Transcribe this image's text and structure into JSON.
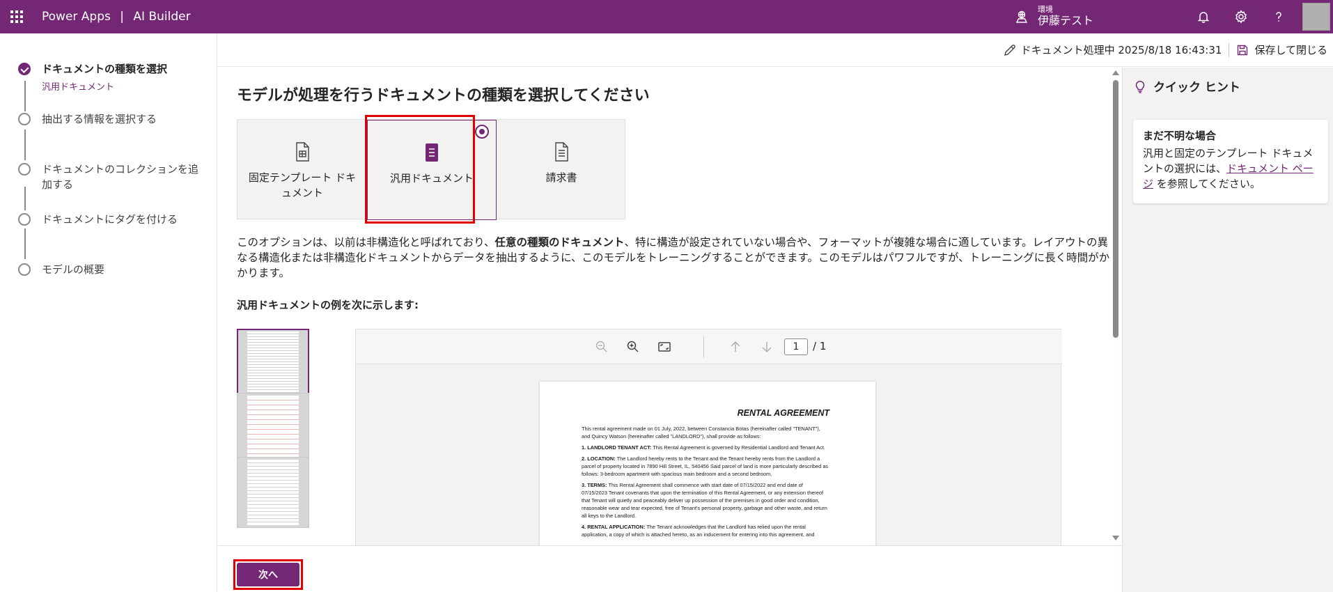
{
  "topbar": {
    "app": "Power Apps",
    "divider": "|",
    "product": "AI Builder",
    "env_label": "環境",
    "env_name": "伊藤テスト"
  },
  "steps": [
    {
      "label": "ドキュメントの種類を選択",
      "sub": "汎用ドキュメント",
      "state": "done"
    },
    {
      "label": "抽出する情報を選択する",
      "state": "pending"
    },
    {
      "label": "ドキュメントのコレクションを追加する",
      "state": "pending"
    },
    {
      "label": "ドキュメントにタグを付ける",
      "state": "pending"
    },
    {
      "label": "モデルの概要",
      "state": "pending"
    }
  ],
  "subheader": {
    "status": "ドキュメント処理中 2025/8/18 16:43:31",
    "save": "保存して閉じる"
  },
  "main": {
    "title": "モデルが処理を行うドキュメントの種類を選択してください",
    "cards": [
      {
        "label": "固定テンプレート ドキュメント",
        "icon": "form-document-icon",
        "selected": false
      },
      {
        "label": "汎用ドキュメント",
        "icon": "document-lines-icon",
        "selected": true
      },
      {
        "label": "請求書",
        "icon": "invoice-document-icon",
        "selected": false
      }
    ],
    "desc_pre": "このオプションは、以前は非構造化と呼ばれており、",
    "desc_bold": "任意の種類のドキュメント",
    "desc_post": "、特に構造が設定されていない場合や、フォーマットが複雑な場合に適しています。レイアウトの異なる構造化または非構造化ドキュメントからデータを抽出するように、このモデルをトレーニングすることができます。このモデルはパワフルですが、トレーニングに長く時間がかかります。",
    "examples_title": "汎用ドキュメントの例を次に示します:"
  },
  "viewer": {
    "page": "1",
    "total": "/ 1",
    "doc_title": "RENTAL AGREEMENT",
    "intro": "This rental agreement made on 01 July, 2022, between Constancia Botas (hereinafter called \"TENANT\"), and Quincy Watson (hereinafter called \"LANDLORD\"), shall provide as follows:",
    "s1_head": "1. LANDLORD TENANT ACT:",
    "s1_body": " This Rental Agreement is governed by Residential Landlord and Tenant Act.",
    "s2_head": "2. LOCATION:",
    "s2_body": " The Landlord hereby rents to the Tenant and the Tenant hereby rents from the Landlord a parcel of property located in 7890 Hill Street, IL, 540456 Said parcel of land is more particularly described as follows: 3-bedroom apartment with spacious main bedroom and a second bedroom,",
    "s3_head": "3. TERMS:",
    "s3_body": " This Rental Agreement shall commence with start date of 07/15/2022 and end date of 07/15/2023 Tenant covenants that upon the termination of this Rental Agreement, or any extension thereof that Tenant will quietly and peaceably deliver up possession of the premises in good order and condition, reasonable wear and tear expected, free of Tenant's personal property, garbage and other waste, and return all keys to the Landlord.",
    "s4_head": "4. RENTAL APPLICATION:",
    "s4_body": " The Tenant acknowledges that the Landlord has relied upon the rental application, a copy of which is attached hereto, as an inducement for entering into this agreement, and"
  },
  "footer": {
    "next": "次へ"
  },
  "hint": {
    "header": "クイック ヒント",
    "title": "まだ不明な場合",
    "text_pre": "汎用と固定のテンプレート ドキュメントの選択には、",
    "link": "ドキュメント ページ",
    "text_post": " を参照してください。"
  },
  "colors": {
    "brand": "#742774",
    "highlight": "#e00000"
  }
}
